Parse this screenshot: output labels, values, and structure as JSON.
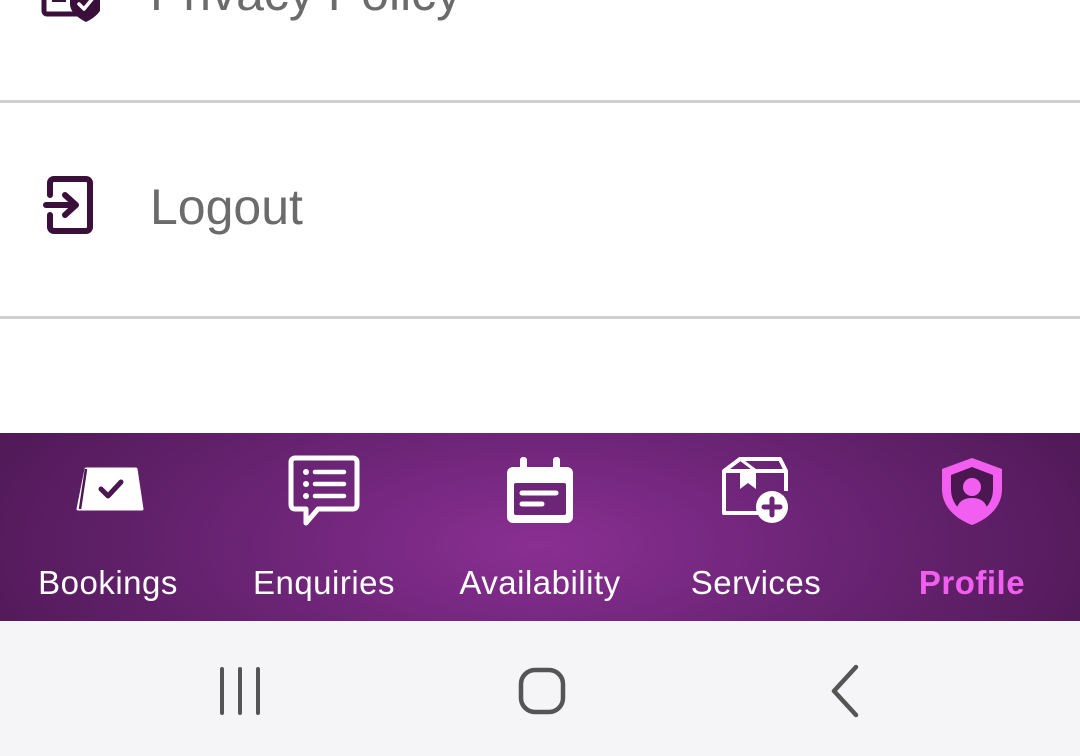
{
  "menu": {
    "privacy_label": "Privacy Policy",
    "privacy_icon": "privacy-shield-document-icon",
    "logout_label": "Logout",
    "logout_icon": "logout-icon"
  },
  "bottom_nav": {
    "active": "Profile",
    "active_color": "#f25ff0",
    "background_color": "#6d2577",
    "items": [
      {
        "label": "Bookings",
        "icon": "bookings-icon"
      },
      {
        "label": "Enquiries",
        "icon": "chat-list-icon"
      },
      {
        "label": "Availability",
        "icon": "calendar-icon"
      },
      {
        "label": "Services",
        "icon": "box-add-icon"
      },
      {
        "label": "Profile",
        "icon": "user-shield-icon"
      }
    ]
  },
  "system_nav": {
    "buttons": [
      "recent-apps",
      "home",
      "back"
    ]
  }
}
